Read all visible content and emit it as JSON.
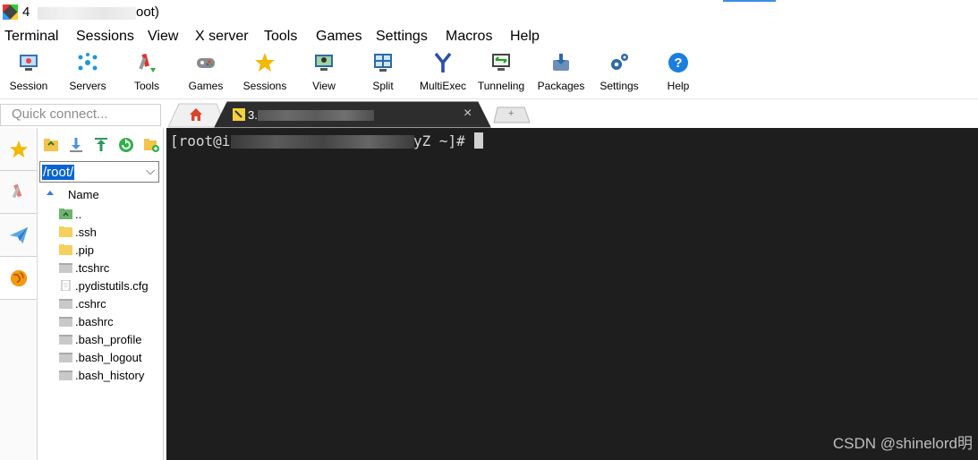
{
  "window": {
    "title_prefix": "4",
    "title_suffix": "oot)"
  },
  "menu": [
    "Terminal",
    "Sessions",
    "View",
    "X server",
    "Tools",
    "Games",
    "Settings",
    "Macros",
    "Help"
  ],
  "toolbar": [
    {
      "label": "Session",
      "icon": "session-icon"
    },
    {
      "label": "Servers",
      "icon": "servers-icon"
    },
    {
      "label": "Tools",
      "icon": "tools-icon"
    },
    {
      "label": "Games",
      "icon": "games-icon"
    },
    {
      "label": "Sessions",
      "icon": "sessions-star-icon"
    },
    {
      "label": "View",
      "icon": "view-icon"
    },
    {
      "label": "Split",
      "icon": "split-icon"
    },
    {
      "label": "MultiExec",
      "icon": "multiexec-icon"
    },
    {
      "label": "Tunneling",
      "icon": "tunneling-icon"
    },
    {
      "label": "Packages",
      "icon": "packages-icon"
    },
    {
      "label": "Settings",
      "icon": "settings-icon"
    },
    {
      "label": "Help",
      "icon": "help-icon"
    }
  ],
  "quick_connect": {
    "placeholder": "Quick connect..."
  },
  "tabs": {
    "active_label_prefix": "3.",
    "close": "×",
    "new_tab": "+"
  },
  "sftp": {
    "path": "/root/",
    "column_name": "Name",
    "files": [
      {
        "name": "..",
        "type": "parent"
      },
      {
        "name": ".ssh",
        "type": "folder"
      },
      {
        "name": ".pip",
        "type": "folder"
      },
      {
        "name": ".tcshrc",
        "type": "file"
      },
      {
        "name": ".pydistutils.cfg",
        "type": "doc"
      },
      {
        "name": ".cshrc",
        "type": "file"
      },
      {
        "name": ".bashrc",
        "type": "file"
      },
      {
        "name": ".bash_profile",
        "type": "file"
      },
      {
        "name": ".bash_logout",
        "type": "file"
      },
      {
        "name": ".bash_history",
        "type": "file"
      }
    ]
  },
  "terminal": {
    "prompt_start": "[root@i",
    "prompt_end": "yZ ~]#"
  },
  "watermark": "CSDN @shinelord明",
  "colors": {
    "terminal_bg": "#1e1e1e",
    "selection": "#0a64d1",
    "accent": "#3b8ee6"
  }
}
